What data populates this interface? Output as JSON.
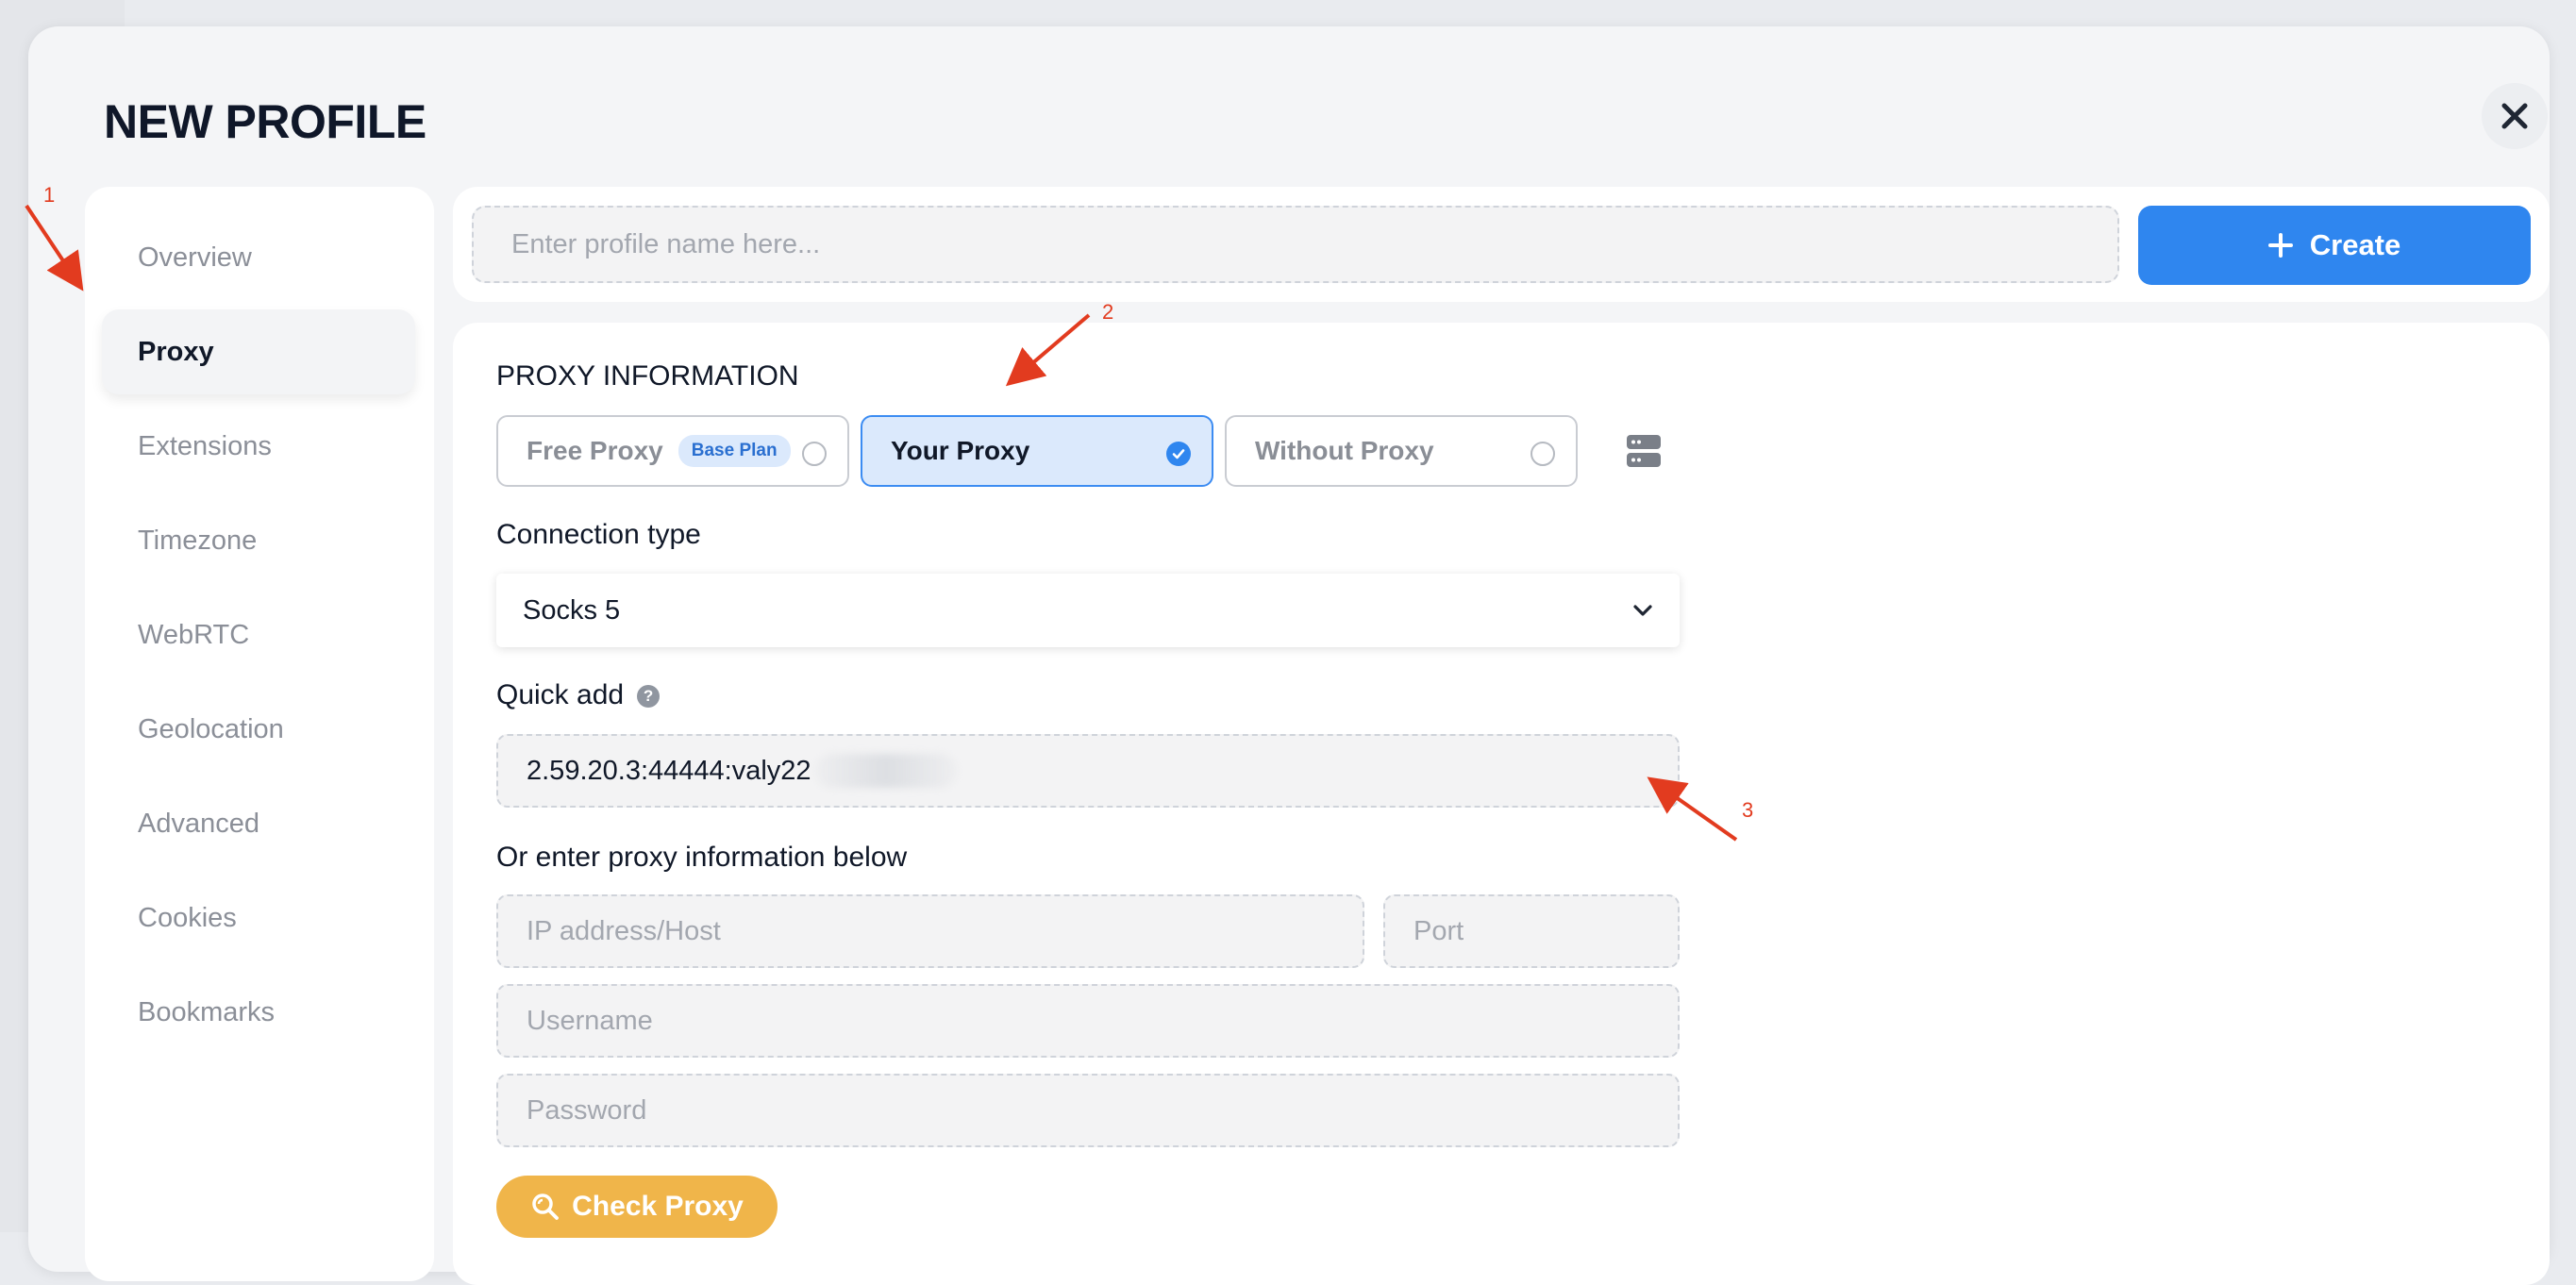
{
  "modal": {
    "title": "NEW PROFILE",
    "close_icon": "close-icon"
  },
  "sidebar": {
    "items": [
      {
        "label": "Overview",
        "active": false
      },
      {
        "label": "Proxy",
        "active": true
      },
      {
        "label": "Extensions",
        "active": false
      },
      {
        "label": "Timezone",
        "active": false
      },
      {
        "label": "WebRTC",
        "active": false
      },
      {
        "label": "Geolocation",
        "active": false
      },
      {
        "label": "Advanced",
        "active": false
      },
      {
        "label": "Cookies",
        "active": false
      },
      {
        "label": "Bookmarks",
        "active": false
      }
    ]
  },
  "header": {
    "name_placeholder": "Enter profile name here...",
    "create_label": "Create"
  },
  "proxy": {
    "section_title": "PROXY INFORMATION",
    "options": [
      {
        "label": "Free Proxy",
        "badge": "Base Plan",
        "selected": false
      },
      {
        "label": "Your Proxy",
        "selected": true
      },
      {
        "label": "Without Proxy",
        "selected": false
      }
    ],
    "connection_type_label": "Connection type",
    "connection_type_value": "Socks 5",
    "quick_add_label": "Quick add",
    "quick_add_help": "?",
    "quick_add_value": "2.59.20.3:44444:valy22",
    "manual_label": "Or enter proxy information below",
    "ip_placeholder": "IP address/Host",
    "port_placeholder": "Port",
    "username_placeholder": "Username",
    "password_placeholder": "Password",
    "check_label": "Check Proxy"
  },
  "annotations": [
    "1",
    "2",
    "3"
  ],
  "colors": {
    "accent": "#2f86ef",
    "check_button": "#f0b54a",
    "annotation": "#e23b1f"
  }
}
